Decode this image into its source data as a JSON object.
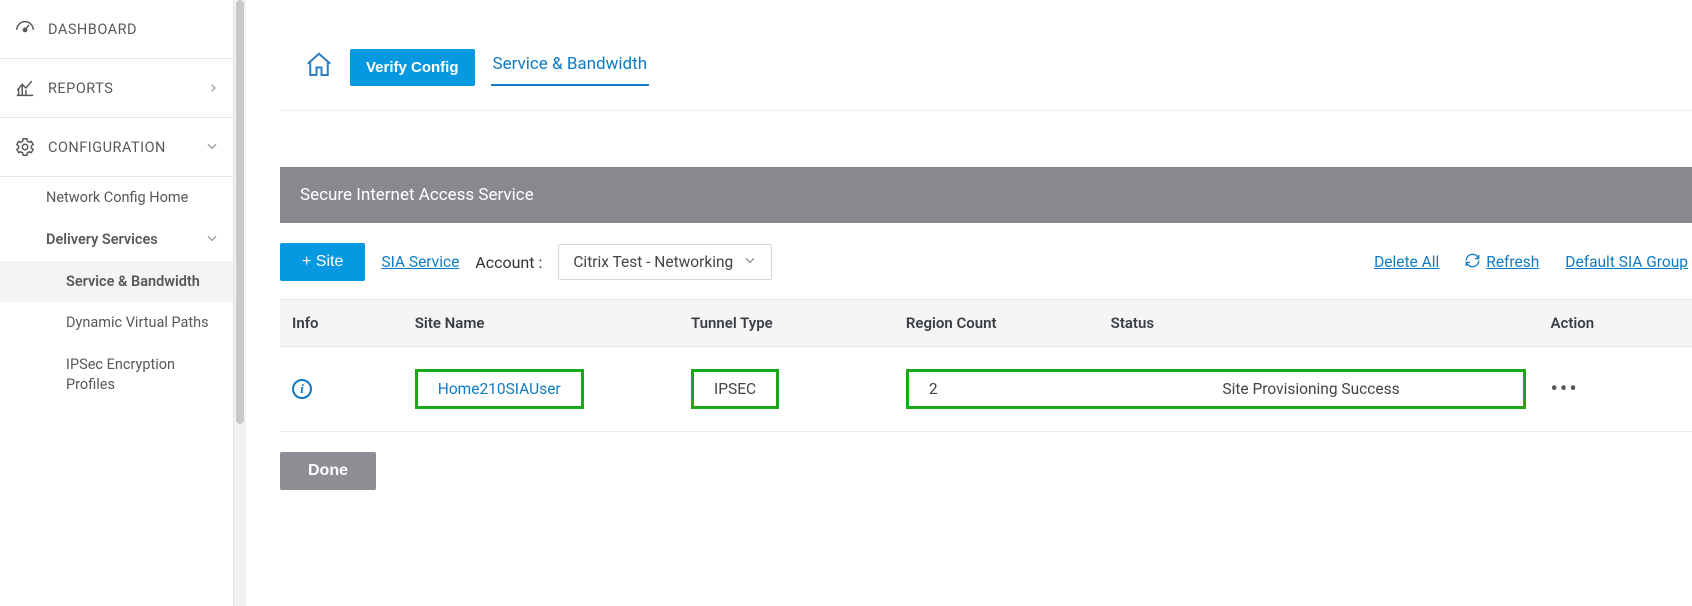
{
  "sidebar": {
    "dashboard": "DASHBOARD",
    "reports": "REPORTS",
    "configuration": "CONFIGURATION",
    "items": {
      "network_home": "Network Config Home",
      "delivery_services": "Delivery Services",
      "service_bandwidth": "Service & Bandwidth",
      "dynamic_virtual_paths": "Dynamic Virtual Paths",
      "ipsec_profiles": "IPSec Encryption Profiles"
    }
  },
  "crumb": {
    "verify_config": "Verify Config",
    "service_bw": "Service & Bandwidth"
  },
  "section_title": "Secure Internet Access Service",
  "toolbar": {
    "add_site": "+ Site",
    "sia_service": "SIA Service",
    "account_label": "Account :",
    "account_value": "Citrix Test - Networking",
    "delete_all": "Delete All",
    "refresh": "Refresh",
    "default_group": "Default SIA Group"
  },
  "table": {
    "headers": {
      "info": "Info",
      "site_name": "Site Name",
      "tunnel_type": "Tunnel Type",
      "region_count": "Region Count",
      "status": "Status",
      "action": "Action"
    },
    "rows": [
      {
        "site_name": "Home210SIAUser",
        "tunnel_type": "IPSEC",
        "region_count": "2",
        "status": "Site Provisioning Success"
      }
    ]
  },
  "done_label": "Done"
}
